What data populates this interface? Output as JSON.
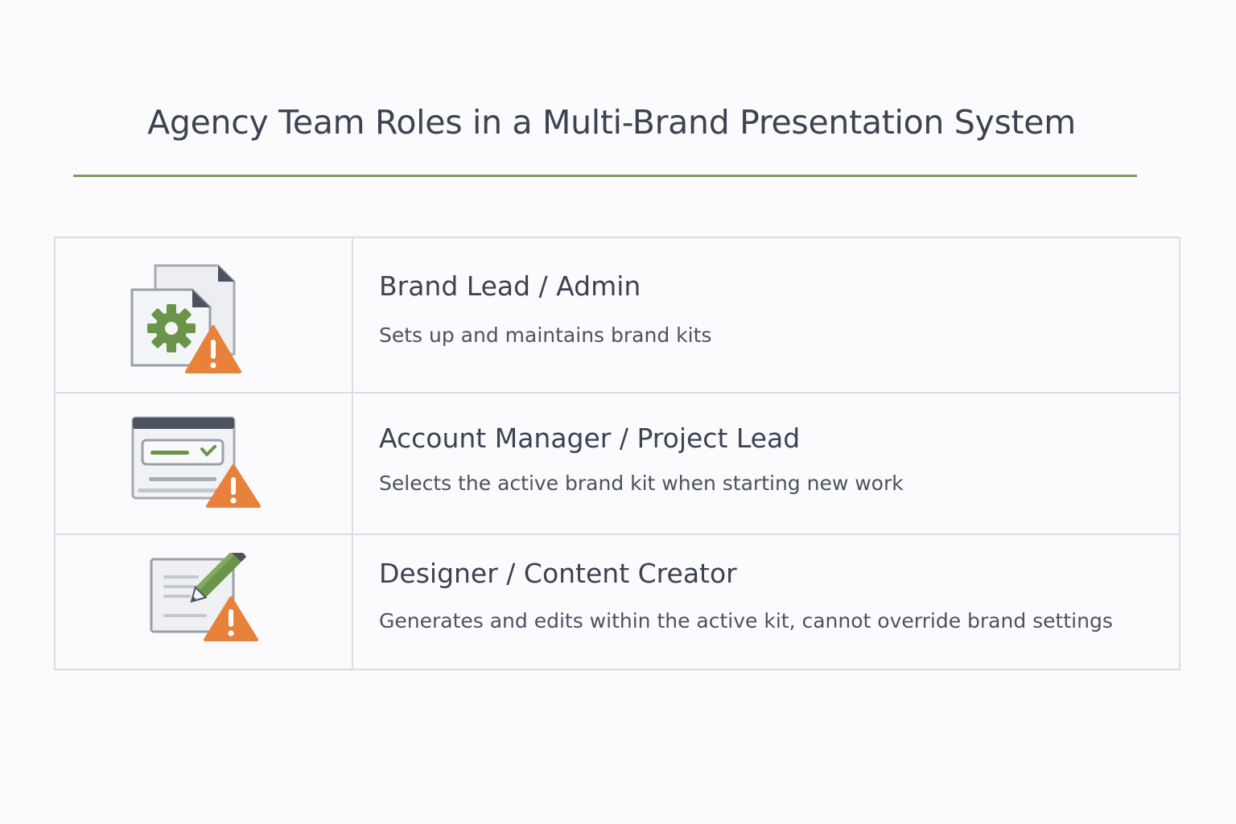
{
  "page": {
    "title": "Agency Team Roles in a Multi-Brand Presentation System"
  },
  "colors": {
    "accent_green": "#6a944a",
    "rule_green": "#7e9e5e",
    "warning_orange": "#e8823a",
    "text_dark": "#3b4352",
    "border_gray": "#dcdde2"
  },
  "roles": [
    {
      "title": "Brand Lead / Admin",
      "description": "Sets up and maintains brand kits",
      "icon": "documents-gear-warning-icon"
    },
    {
      "title": "Account Manager / Project Lead",
      "description": "Selects the active brand kit when starting   new work",
      "icon": "window-selector-warning-icon"
    },
    {
      "title": "Designer / Content Creator",
      "description": "Generates and edits within the active kit, cannot override brand settings",
      "icon": "document-pencil-warning-icon"
    }
  ]
}
